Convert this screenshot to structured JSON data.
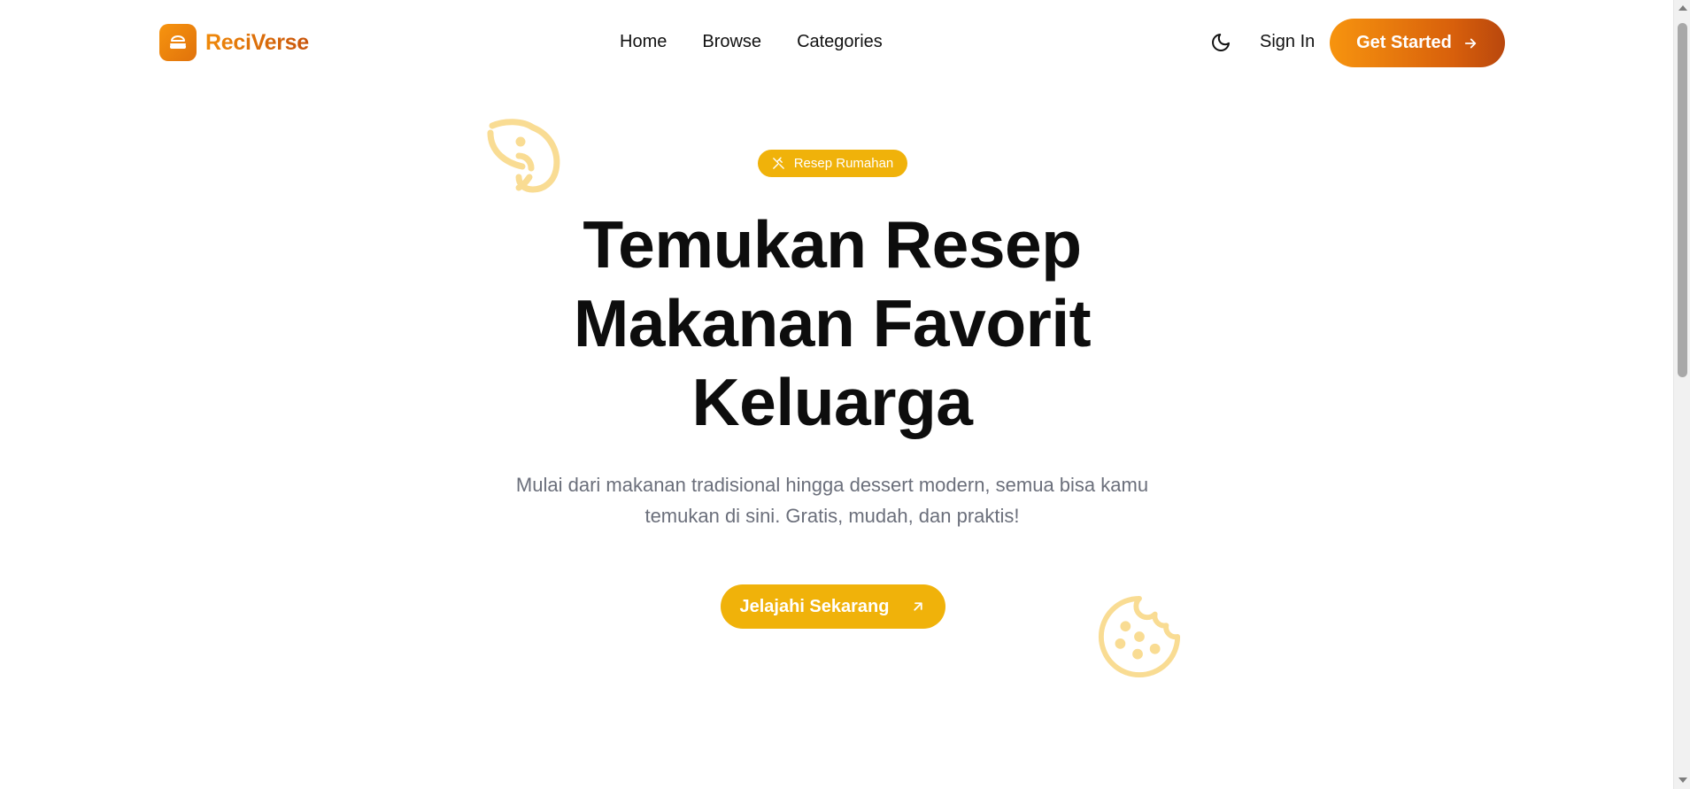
{
  "brand": {
    "name": "ReciVerse",
    "logo_icon": "burger-icon",
    "color_start": "#f7940e",
    "color_end": "#c8540b"
  },
  "nav": {
    "links": [
      {
        "label": "Home"
      },
      {
        "label": "Browse"
      },
      {
        "label": "Categories"
      }
    ],
    "theme_toggle_icon": "moon-icon",
    "signin_label": "Sign In",
    "get_started_label": "Get Started",
    "get_started_icon": "arrow-right-icon"
  },
  "hero": {
    "badge_icon": "utensils-crossed-icon",
    "badge_label": "Resep Rumahan",
    "title_lines": [
      "Temukan Resep",
      "Makanan Favorit",
      "Keluarga"
    ],
    "subtitle_lines": [
      "Mulai dari makanan tradisional hingga dessert modern, semua bisa kamu",
      "temukan di sini. Gratis, mudah, dan praktis!"
    ],
    "cta_label": "Jelajahi Sekarang",
    "cta_icon": "arrow-up-right-icon",
    "decorations": [
      "shrimp-icon",
      "cookie-icon"
    ]
  },
  "colors": {
    "accent_yellow": "#f0b20a",
    "accent_orange": "#f7940e",
    "subtitle_gray": "#6b6f7b"
  }
}
